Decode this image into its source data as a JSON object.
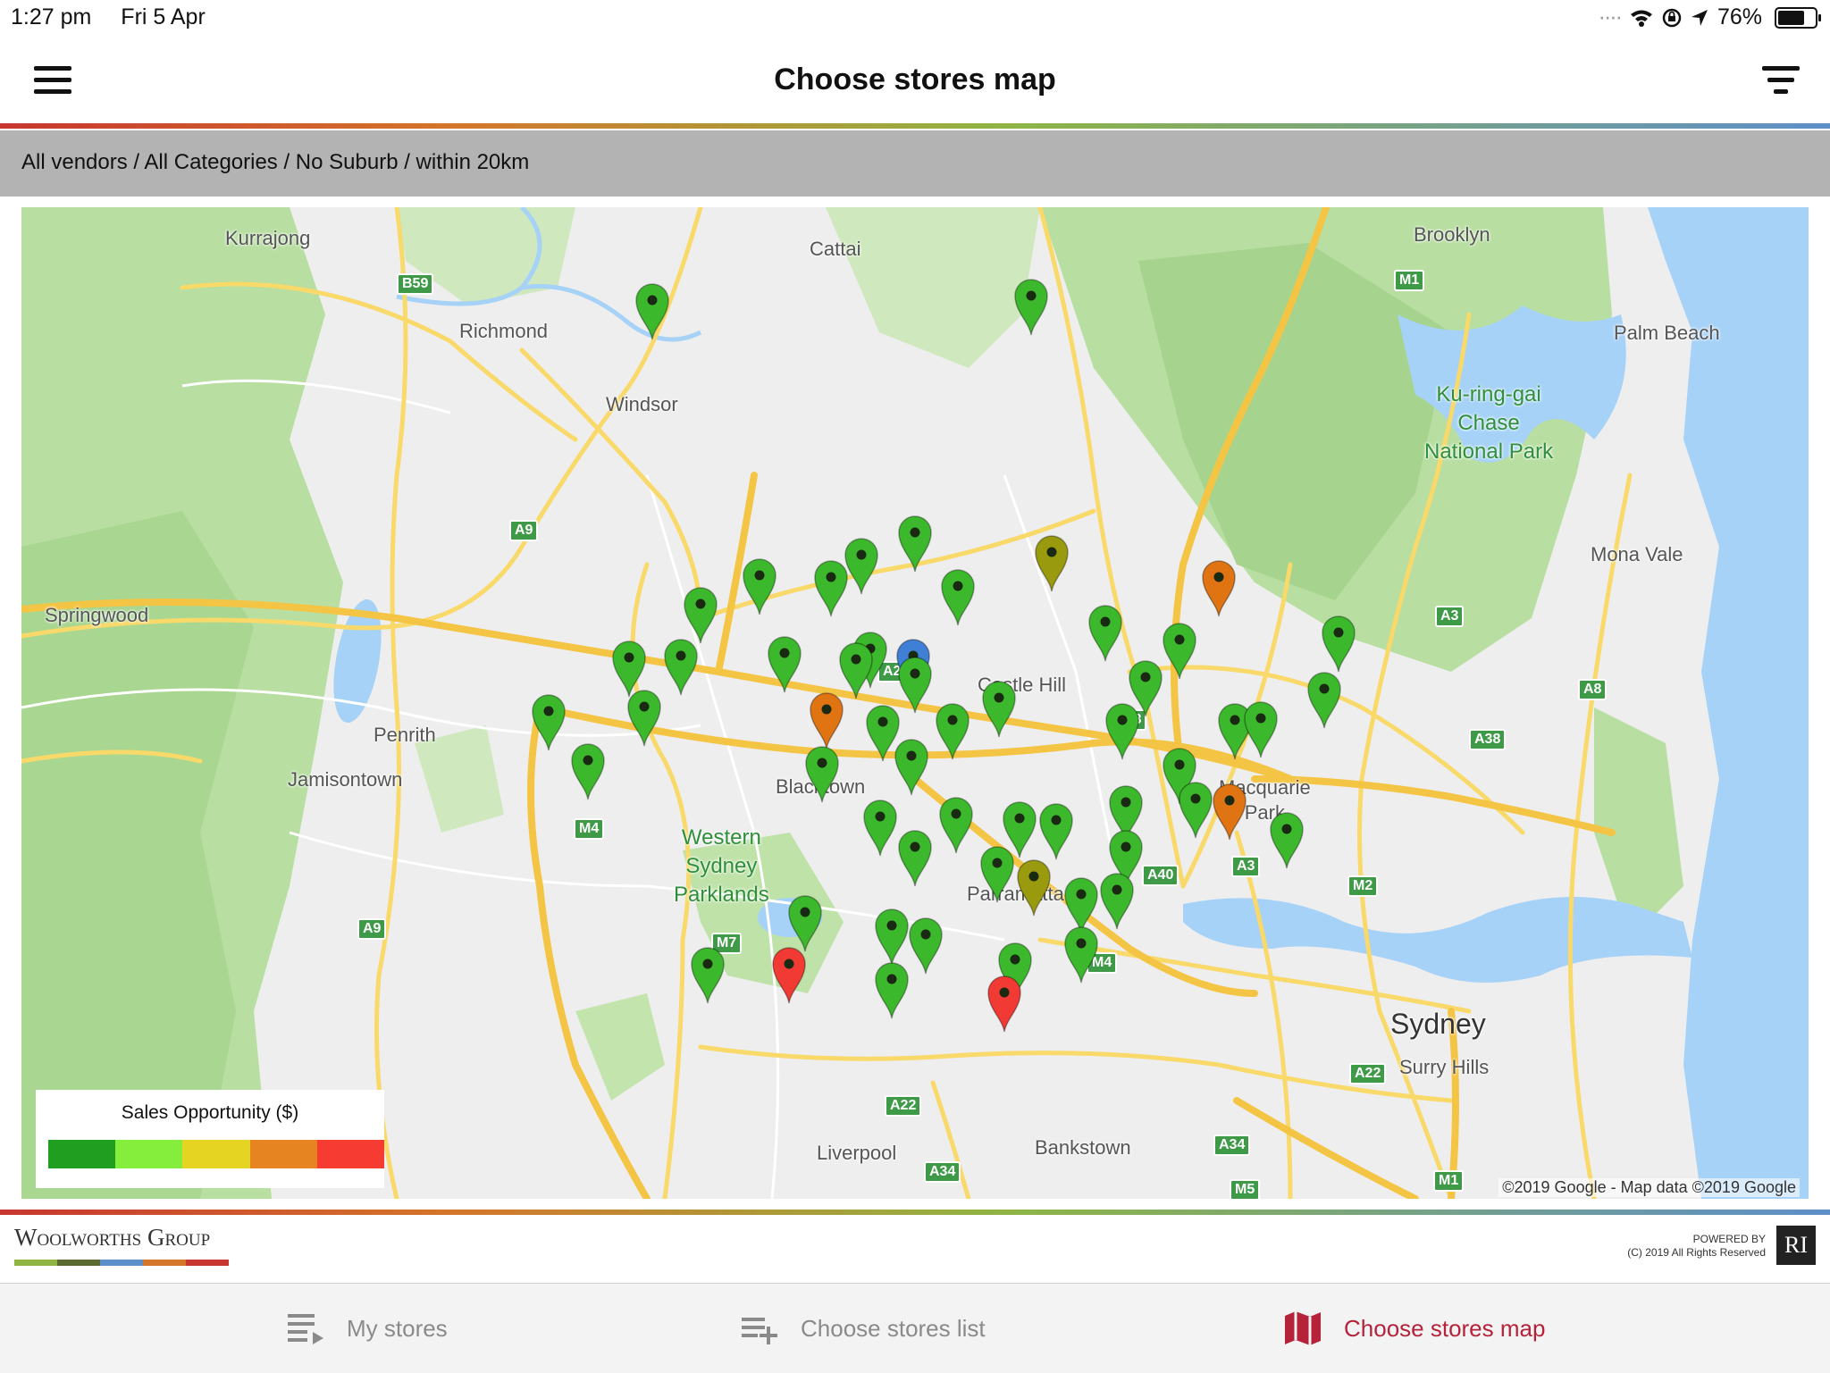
{
  "status_bar": {
    "time": "1:27 pm",
    "date": "Fri 5 Apr",
    "battery": "76%",
    "battery_level": 0.76
  },
  "header": {
    "title": "Choose stores map",
    "menu_icon": "hamburger-menu-icon",
    "filter_icon": "filter-icon"
  },
  "filter_summary": "All vendors / All Categories / No Suburb / within 20km",
  "map": {
    "places": {
      "kurrajong": "Kurrajong",
      "cattai": "Cattai",
      "brooklyn": "Brooklyn",
      "richmond": "Richmond",
      "windsor": "Windsor",
      "palm_beach": "Palm Beach",
      "kuringgai": "Ku-ring-gai\nChase\nNational Park",
      "mona_vale": "Mona Vale",
      "springwood": "Springwood",
      "castle_hill": "Castle Hill",
      "penrith": "Penrith",
      "jamisontown": "Jamisontown",
      "blacktown": "Blacktown",
      "macquarie_park": "Macquarie\nPark",
      "western_sydney_parklands": "Western\nSydney\nParklands",
      "parramatta": "Parramatta",
      "sydney": "Sydney",
      "surry_hills": "Surry Hills",
      "liverpool": "Liverpool",
      "bankstown": "Bankstown"
    },
    "roads": {
      "b59": "B59",
      "m1_north": "M1",
      "a9_north": "A9",
      "a3_north": "A3",
      "a8": "A8",
      "a38": "A38",
      "a28": "A28",
      "a2": "A2",
      "m4_west": "M4",
      "a3_mid": "A3",
      "m2": "M2",
      "a40": "A40",
      "a9_south": "A9",
      "m7": "M7",
      "m4_east": "M4",
      "a22_east": "A22",
      "a22_south": "A22",
      "a34_east": "A34",
      "a34_south": "A34",
      "m5": "M5",
      "m1_south": "M1"
    },
    "copyright": "©2019 Google - Map data ©2019 Google"
  },
  "legend": {
    "title": "Sales Opportunity ($)",
    "colors": [
      "#1f9e1f",
      "#85ee3c",
      "#e6d422",
      "#e58420",
      "#f63b33"
    ]
  },
  "footer": {
    "logo_text": "Woolworths Group",
    "logo_stripe_colors": [
      "#8fb444",
      "#5c6a30",
      "#5d8fc9",
      "#d4762a",
      "#c7362f"
    ],
    "powered_by": "POWERED BY",
    "rights": "(C) 2019 All Rights Reserved",
    "ri_logo": "RI"
  },
  "tabs": [
    {
      "label": "My stores",
      "icon": "list-arrow-icon",
      "active": false
    },
    {
      "label": "Choose stores list",
      "icon": "playlist-add-icon",
      "active": false
    },
    {
      "label": "Choose stores map",
      "icon": "map-icon",
      "active": true
    }
  ],
  "active_color": "#b5223a",
  "pin_colors": {
    "green": "#3cb82c",
    "olive": "#9a9a0f",
    "orange": "#e07412",
    "red": "#f23a35",
    "blue": "#3f7fd6"
  }
}
